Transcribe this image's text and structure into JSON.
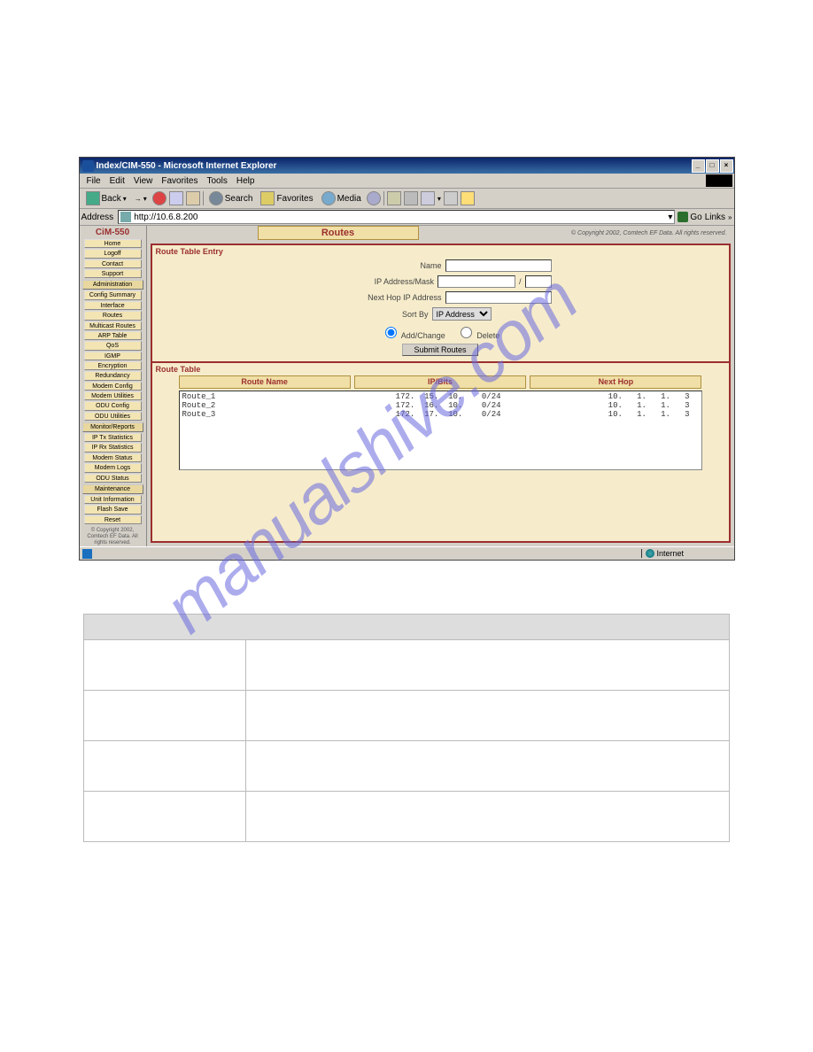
{
  "window": {
    "title": "Index/CIM-550 - Microsoft Internet Explorer"
  },
  "menubar": {
    "file": "File",
    "edit": "Edit",
    "view": "View",
    "favorites": "Favorites",
    "tools": "Tools",
    "help": "Help"
  },
  "toolbar": {
    "back": "Back",
    "search": "Search",
    "favorites": "Favorites",
    "media": "Media"
  },
  "addrbar": {
    "label": "Address",
    "value": "http://10.6.8.200",
    "go": "Go",
    "links": "Links"
  },
  "sidebar": {
    "brand": "CiM-550",
    "home": "Home",
    "logoff": "Logoff",
    "contact": "Contact",
    "support": "Support",
    "sec_admin": "Administration",
    "config_summary": "Config Summary",
    "interface": "Interface",
    "routes": "Routes",
    "multicast_routes": "Multicast Routes",
    "arp_table": "ARP Table",
    "qos": "QoS",
    "igmp": "IGMP",
    "encryption": "Encryption",
    "redundancy": "Redundancy",
    "modem_config": "Modem Config",
    "modem_utilities": "Modem Utilities",
    "odu_config": "ODU Config",
    "odu_utilities": "ODU Utilities",
    "sec_monitor": "Monitor/Reports",
    "ip_tx": "IP Tx Statistics",
    "ip_rx": "IP Rx Statistics",
    "modem_status": "Modem Status",
    "modem_logs": "Modem Logs",
    "odu_status": "ODU Status",
    "sec_maint": "Maintenance",
    "unit_info": "Unit Information",
    "flash_save": "Flash Save",
    "reset": "Reset",
    "footer": "© Copyright 2002, Comtech EF Data. All rights reserved."
  },
  "header": {
    "title": "Routes",
    "copy": "© Copyright 2002, Comtech EF Data. All rights reserved."
  },
  "form": {
    "section_entry": "Route Table Entry",
    "name_label": "Name",
    "ip_label": "IP Address/Mask",
    "nexthop_label": "Next Hop IP Address",
    "sortby_label": "Sort By",
    "sortby_value": "IP Address",
    "add_change": "Add/Change",
    "delete": "Delete",
    "submit": "Submit Routes",
    "section_table": "Route Table",
    "col_name": "Route Name",
    "col_ip": "IP/Bits",
    "col_next": "Next Hop"
  },
  "routes": [
    {
      "name": "Route_1",
      "ip": "172.  15.  10.    0/24",
      "next": "10.   1.   1.   3"
    },
    {
      "name": "Route_2",
      "ip": "172.  16.  10.    0/24",
      "next": "10.   1.   1.   3"
    },
    {
      "name": "Route_3",
      "ip": "172.  17.  10.    0/24",
      "next": "10.   1.   1.   3"
    }
  ],
  "statusbar": {
    "done": "",
    "zone": "Internet"
  },
  "watermark": "manualshive.com"
}
